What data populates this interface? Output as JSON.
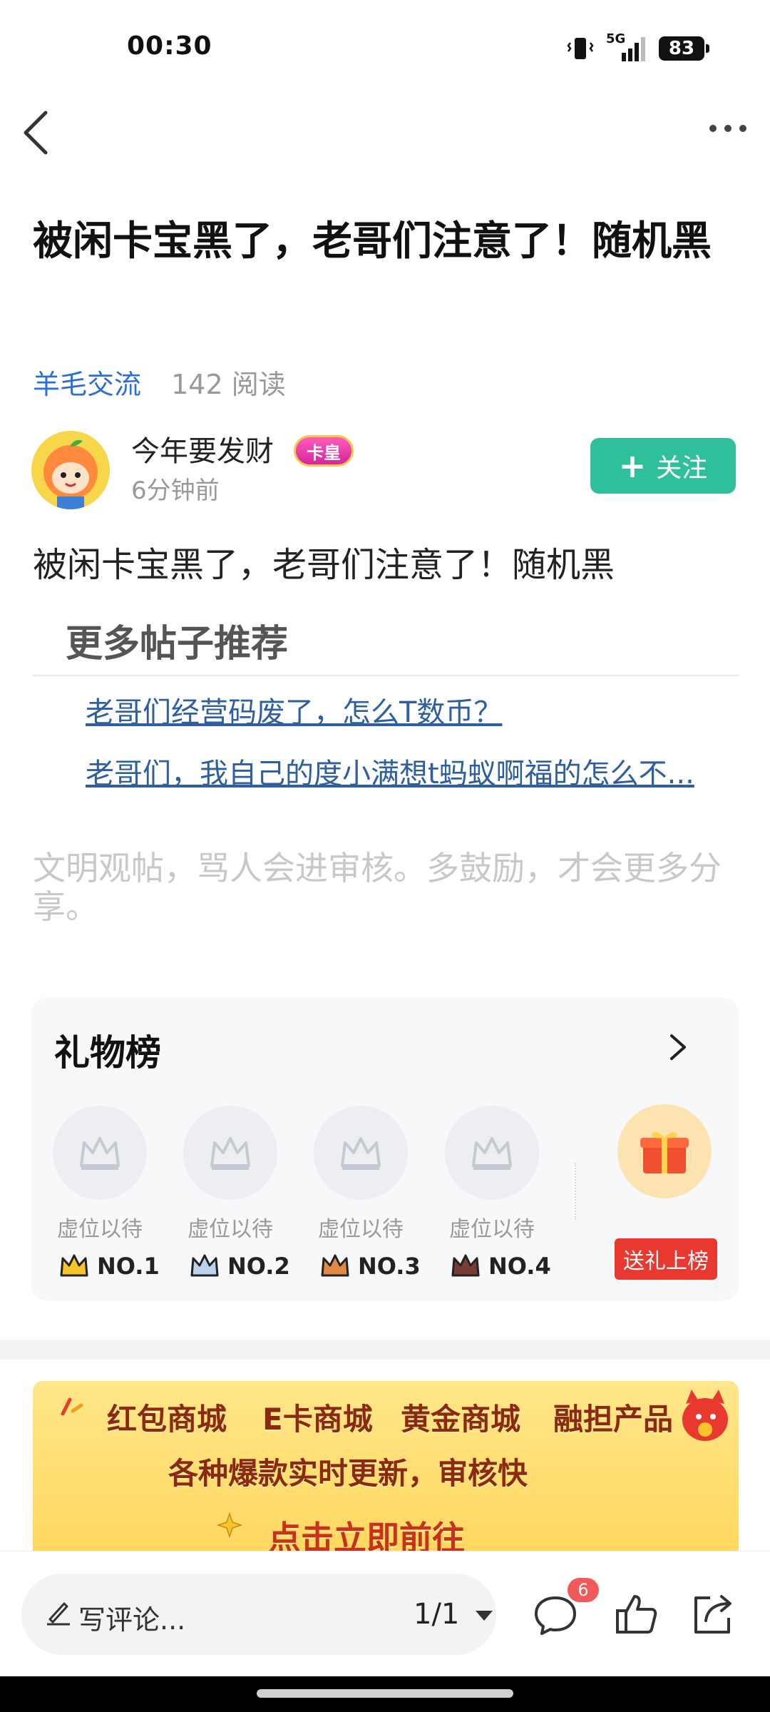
{
  "status_bar": {
    "time": "00:30",
    "network": "5G",
    "battery": "83"
  },
  "post": {
    "title": "被闲卡宝黑了，老哥们注意了！随机黑",
    "category": "羊毛交流",
    "reads": "142 阅读",
    "author": {
      "name": "今年要发财",
      "badge": "卡皇",
      "time": "6分钟前"
    },
    "follow_label": "关注",
    "body": "被闲卡宝黑了，老哥们注意了！随机黑"
  },
  "recommend": {
    "heading": "更多帖子推荐",
    "links": [
      "老哥们经营码废了，怎么T数币？",
      "老哥们，我自己的度小满想t蚂蚁啊福的怎么不..."
    ]
  },
  "notice": "文明观帖，骂人会进审核。多鼓励，才会更多分享。",
  "gift_board": {
    "title": "礼物榜",
    "slots": [
      {
        "label": "虚位以待",
        "rank": "NO.1"
      },
      {
        "label": "虚位以待",
        "rank": "NO.2"
      },
      {
        "label": "虚位以待",
        "rank": "NO.3"
      },
      {
        "label": "虚位以待",
        "rank": "NO.4"
      }
    ],
    "send_label": "送礼上榜"
  },
  "banner": {
    "items": [
      "红包商城",
      "E卡商城",
      "黄金商城",
      "融担产品"
    ],
    "subtitle": "各种爆款实时更新，审核快",
    "cta": "点击立即前往"
  },
  "bottom_bar": {
    "comment_placeholder": "写评论...",
    "page_indicator": "1/1",
    "comment_count": "6"
  },
  "colors": {
    "accent": "#2fbf9b",
    "link": "#2e5f9e",
    "category": "#2a6fd6",
    "send_button": "#e8382f"
  }
}
